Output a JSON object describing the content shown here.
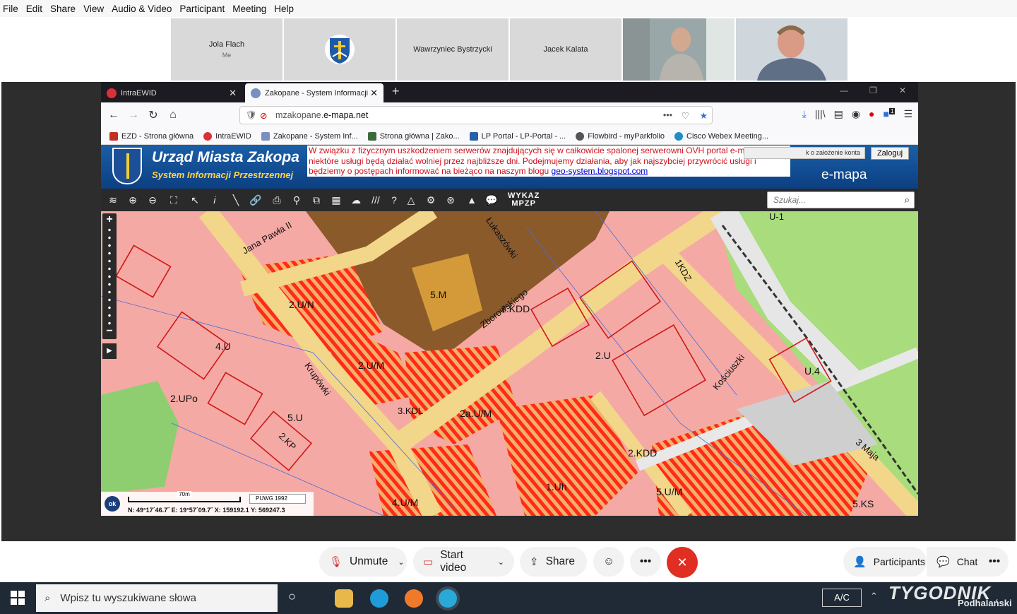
{
  "menu": [
    "File",
    "Edit",
    "Share",
    "View",
    "Audio & Video",
    "Participant",
    "Meeting",
    "Help"
  ],
  "participants": [
    {
      "name": "Jola Flach",
      "sub": "Me"
    },
    {
      "name": "",
      "sub": ""
    },
    {
      "name": "Wawrzyniec Bystrzycki",
      "sub": ""
    },
    {
      "name": "Jacek Kalata",
      "sub": ""
    }
  ],
  "browser": {
    "tabs": [
      {
        "label": "IntraEWID",
        "active": false
      },
      {
        "label": "Zakopane - System Informacji I",
        "active": true
      }
    ],
    "url_prefix": "mzakopane.",
    "url_domain": "e-mapa.net",
    "bookmarks": [
      "EZD - Strona główna",
      "IntraEWID",
      "Zakopane - System Inf...",
      "Strona główna | Zako...",
      "LP Portal - LP-Portal - ...",
      "Flowbird - myParkfolio",
      "Cisco Webex Meeting..."
    ],
    "notification_badge": "1"
  },
  "site": {
    "title": "Urząd Miasta Zakopa",
    "subtitle": "System Informacji Przestrzennej",
    "notice_l1": "W związku z fizycznym uszkodzeniem serwerów znajdujących się w całkowicie spalonej serwerowni OVH portal e-mapa i",
    "notice_l2": "niektóre usługi będą działać wolniej przez najbliższe dni. Podejmujemy działania, aby jak najszybciej przywrócić usługi i",
    "notice_l3": "będziemy o postępach informować na bieżąco na naszym blogu ",
    "notice_link": "geo-system.blogspot.com",
    "login_hint": "k o założenie konta",
    "login_button": "Zaloguj",
    "brand": "e-mapa",
    "wykaz": "WYKAZ",
    "mpzp": "MPZP",
    "search_placeholder": "Szukaj..."
  },
  "map": {
    "scale_label": "70m",
    "projection": "PUWG 1992",
    "ok": "ok",
    "coords": "N: 49°17´46.7˝  E: 19°57´09.7˝   X: 159192.1   Y: 569247.3",
    "labels": [
      "2.U/M",
      "2.U/M",
      "4.U",
      "2.UPo",
      "5.U",
      "2.U",
      "2a.U/M",
      "1.Uh",
      "2.KDD",
      "5.U/M",
      "4.U/M",
      "U.4",
      "1.KDD",
      "5.M",
      "3.KDL",
      "5.KS",
      "2.KP",
      "Jana Pawła II",
      "Zborowskiego",
      "Łukaszówki",
      "Kościuszki",
      "Krupówki",
      "3 Maja",
      "1KDZ",
      "2.U/N",
      "U-1"
    ],
    "colors": {
      "residential": "#f5a9a4",
      "service_stripe": "#ff2a1a",
      "brown_zone": "#8b5a2b",
      "road": "#f2d68a",
      "green": "#a8dc7c",
      "gray": "#cfcfcf"
    }
  },
  "controls": {
    "unmute": "Unmute",
    "start_video": "Start video",
    "share": "Share",
    "participants": "Participants",
    "chat": "Chat"
  },
  "taskbar": {
    "search_text": "Wpisz tu wyszukiwane słowa",
    "ac": "A/C",
    "watermark": "TYGODNIK",
    "watermark_sub": "Podhalański"
  }
}
